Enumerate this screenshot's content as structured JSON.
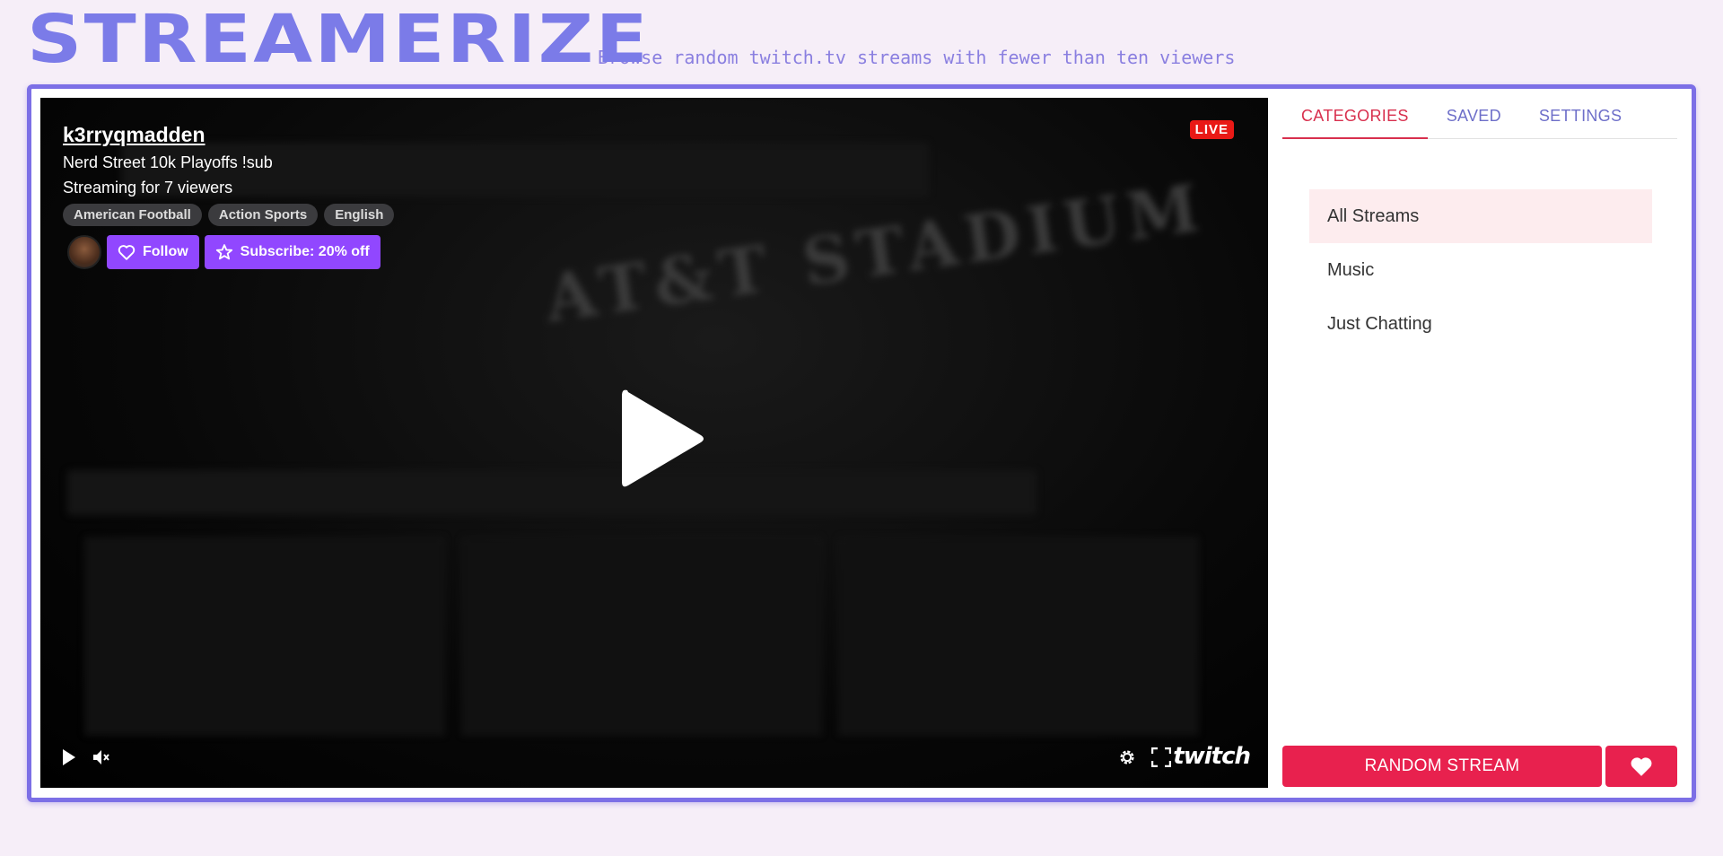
{
  "header": {
    "logo": "STREAMERIZE",
    "tagline": "Browse random twitch.tv streams with fewer than ten viewers"
  },
  "player": {
    "channel_name": "k3rryqmadden",
    "stream_title": "Nerd Street 10k Playoffs !sub",
    "viewer_text": "Streaming for 7 viewers",
    "tags": [
      "American Football",
      "Action Sports",
      "English"
    ],
    "follow_label": "Follow",
    "subscribe_label": "Subscribe: 20% off",
    "live_badge": "LIVE",
    "twitch_logo": "twitch",
    "icons": {
      "play": "play-icon",
      "volume": "volume-icon",
      "settings": "gear-icon",
      "fullscreen": "fullscreen-icon",
      "follow": "heart-outline-icon",
      "subscribe": "star-outline-icon"
    }
  },
  "sidebar": {
    "tabs": [
      {
        "label": "CATEGORIES",
        "active": true
      },
      {
        "label": "SAVED",
        "active": false
      },
      {
        "label": "SETTINGS",
        "active": false
      }
    ],
    "categories": [
      {
        "label": "All Streams",
        "active": true
      },
      {
        "label": "Music",
        "active": false
      },
      {
        "label": "Just Chatting",
        "active": false
      }
    ],
    "random_label": "RANDOM STREAM",
    "heart_icon": "heart-icon"
  },
  "colors": {
    "accent": "#7b7be8",
    "primary_red": "#e8214e",
    "twitch_purple": "#9147ff",
    "live_red": "#e91916",
    "background": "#f6eef8"
  }
}
